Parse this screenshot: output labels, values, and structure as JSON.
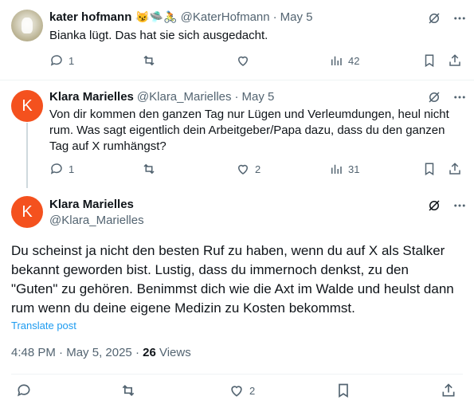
{
  "tweets": [
    {
      "name": "kater hofmann",
      "emojis": "😼🛸🚴",
      "handle": "@KaterHofmann",
      "date": "May 5",
      "text": "Bianka lügt. Das hat sie sich ausgedacht.",
      "replies": "1",
      "retweets": "",
      "likes": "",
      "views": "42"
    },
    {
      "name": "Klara Marielles",
      "avatar_letter": "K",
      "handle": "@Klara_Marielles",
      "date": "May 5",
      "text": "Von dir kommen den ganzen Tag nur Lügen und Verleumdungen, heul nicht rum. Was sagt eigentlich dein Arbeitgeber/Papa dazu, dass du den ganzen Tag auf X rumhängst?",
      "replies": "1",
      "retweets": "",
      "likes": "2",
      "views": "31"
    }
  ],
  "main": {
    "name": "Klara Marielles",
    "avatar_letter": "K",
    "handle": "@Klara_Marielles",
    "text": "Du scheinst ja nicht den besten Ruf zu haben, wenn du auf X als Stalker bekannt geworden bist. Lustig, dass du immernoch denkst, zu den \"Guten\" zu gehören. Benimmst dich wie die Axt im Walde und heulst dann rum  wenn du deine eigene Medizin zu Kosten bekommst.",
    "translate": "Translate post",
    "time": "4:48 PM",
    "date": "May 5, 2025",
    "views_count": "26",
    "views_label": "Views",
    "likes": "2"
  },
  "separator": "·",
  "colors": {
    "avatar_orange": "#f4511e",
    "link_blue": "#1d9bf0",
    "muted": "#536471",
    "text": "#0f1419"
  }
}
